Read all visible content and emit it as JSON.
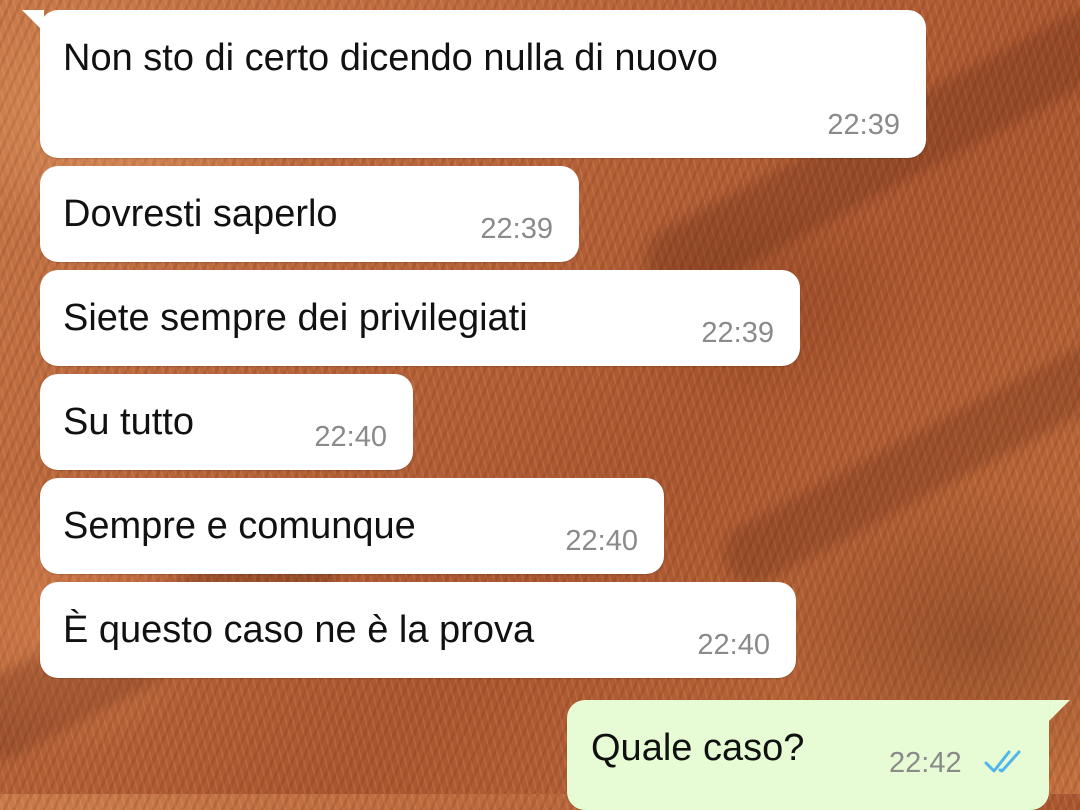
{
  "messages": [
    {
      "direction": "incoming",
      "text": "Non sto di certo dicendo nulla di nuovo",
      "time": "22:39"
    },
    {
      "direction": "incoming",
      "text": "Dovresti saperlo",
      "time": "22:39"
    },
    {
      "direction": "incoming",
      "text": "Siete sempre dei privilegiati",
      "time": "22:39"
    },
    {
      "direction": "incoming",
      "text": "Su tutto",
      "time": "22:40"
    },
    {
      "direction": "incoming",
      "text": "Sempre e comunque",
      "time": "22:40"
    },
    {
      "direction": "incoming",
      "text": "È questo caso ne è la prova",
      "time": "22:40"
    },
    {
      "direction": "outgoing",
      "text": "Quale caso?",
      "time": "22:42",
      "status_icon": "double-check-read-icon"
    }
  ],
  "colors": {
    "incoming_bubble": "#ffffff",
    "outgoing_bubble": "#e7fcd4",
    "read_tick": "#4fb6ec",
    "timestamp": "#8a8a8a"
  }
}
